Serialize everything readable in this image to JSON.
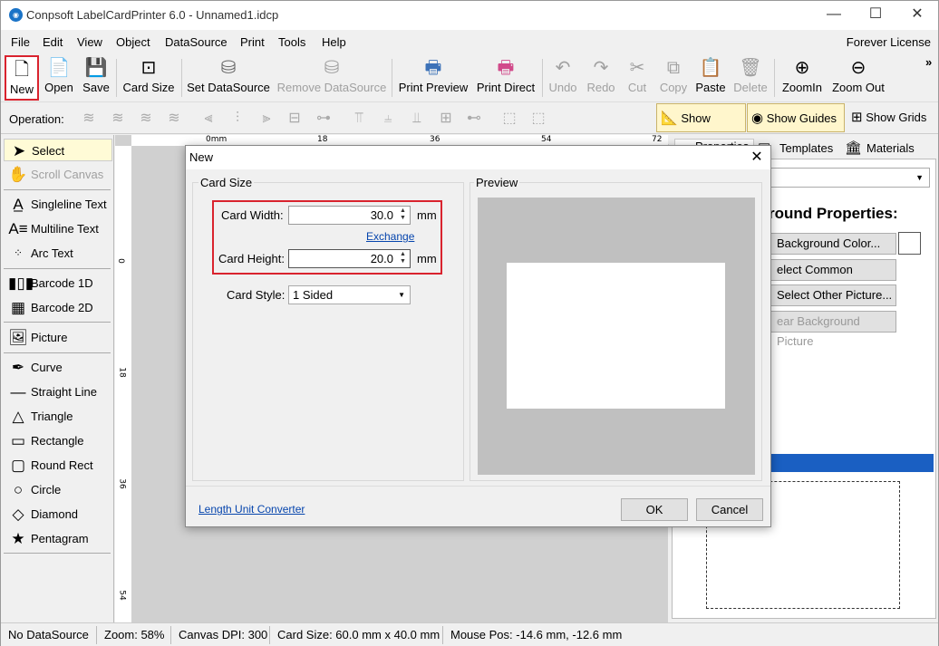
{
  "window": {
    "title": "Conpsoft LabelCardPrinter 6.0 - Unnamed1.idcp",
    "minimize": "—",
    "maximize": "☐",
    "close": "✕"
  },
  "menu": [
    "File",
    "Edit",
    "View",
    "Object",
    "DataSource",
    "Print",
    "Tools",
    "Help"
  ],
  "license": "Forever License",
  "toolbar": {
    "new": "New",
    "open": "Open",
    "save": "Save",
    "card_size": "Card Size",
    "set_datasource": "Set DataSource",
    "remove_datasource": "Remove DataSource",
    "print_preview": "Print Preview",
    "print_direct": "Print Direct",
    "undo": "Undo",
    "redo": "Redo",
    "cut": "Cut",
    "copy": "Copy",
    "paste": "Paste",
    "delete": "Delete",
    "zoomin": "ZoomIn",
    "zoomout": "Zoom Out",
    "more": "»"
  },
  "operation": {
    "label": "Operation:",
    "show_ruler": "Show Ruler",
    "show_guides": "Show Guides",
    "show_grids": "Show Grids"
  },
  "tools": {
    "select": "Select",
    "scroll_canvas": "Scroll Canvas",
    "singleline_text": "Singleline Text",
    "multiline_text": "Multiline Text",
    "arc_text": "Arc Text",
    "barcode_1d": "Barcode 1D",
    "barcode_2d": "Barcode 2D",
    "picture": "Picture",
    "curve": "Curve",
    "straight_line": "Straight Line",
    "triangle": "Triangle",
    "rectangle": "Rectangle",
    "round_rect": "Round Rect",
    "circle": "Circle",
    "diamond": "Diamond",
    "pentagram": "Pentagram"
  },
  "ruler": {
    "h": [
      "0mm",
      "18",
      "36",
      "54",
      "72"
    ],
    "v": [
      "0",
      "18",
      "36",
      "54"
    ]
  },
  "right_panel": {
    "tab_properties": "Properties",
    "tab_templates": "Templates",
    "tab_materials": "Materials",
    "heading": "round Properties:",
    "bg_color": "Background Color...",
    "common_pic": "elect Common Picture...",
    "other_pic": "Select Other Picture...",
    "clear_bg": "ear Background Picture"
  },
  "status": {
    "datasource": "No DataSource",
    "zoom": "Zoom: 58%",
    "dpi": "Canvas DPI: 300",
    "card_size": "Card Size: 60.0 mm x 40.0 mm",
    "mouse_pos": "Mouse Pos: -14.6 mm, -12.6 mm"
  },
  "dialog": {
    "title": "New",
    "close": "✕",
    "card_size_group": "Card Size",
    "card_width_label": "Card Width:",
    "card_width": "30.0",
    "card_height_label": "Card Height:",
    "card_height": "20.0",
    "unit": "mm",
    "exchange": "Exchange",
    "card_style_label": "Card Style:",
    "card_style": "1 Sided",
    "preview_group": "Preview",
    "unit_converter": "Length Unit Converter",
    "ok": "OK",
    "cancel": "Cancel"
  },
  "colors": {
    "highlight": "#d9232e",
    "preview_bg": "#c0c0c0",
    "accent_blue": "#1a5fc2"
  }
}
